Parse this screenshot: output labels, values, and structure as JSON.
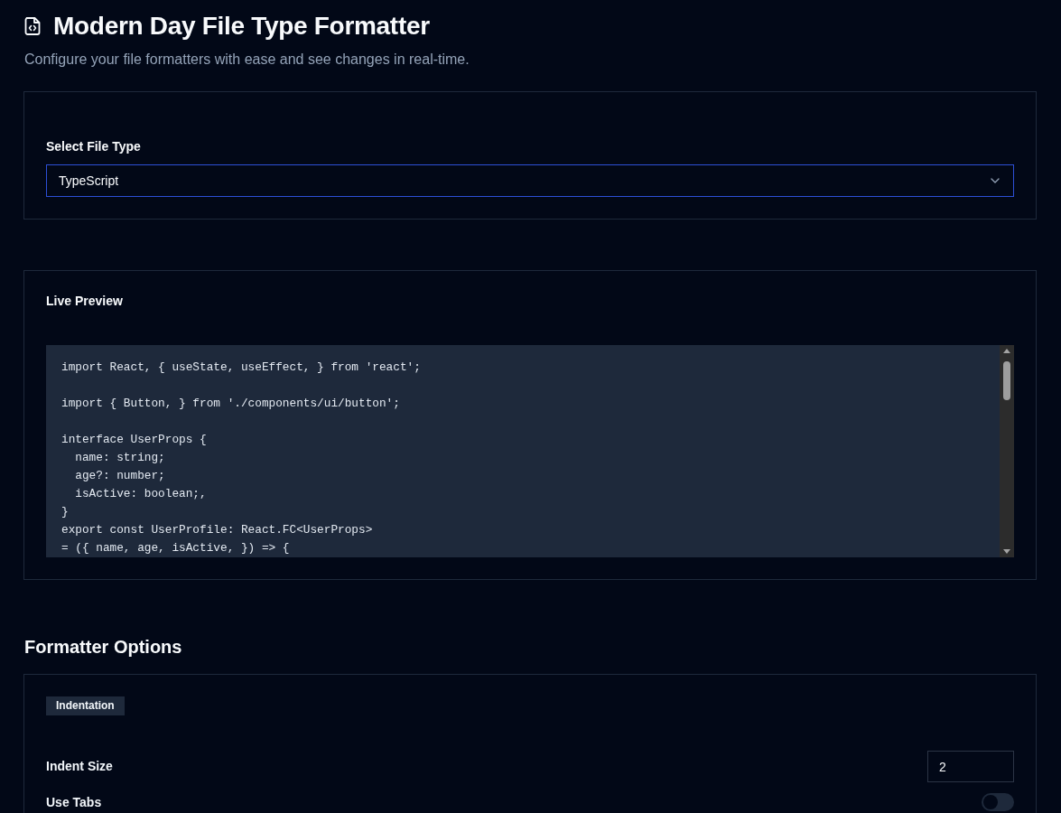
{
  "header": {
    "title": "Modern Day File Type Formatter",
    "subtitle": "Configure your file formatters with ease and see changes in real-time."
  },
  "file_type": {
    "label": "Select File Type",
    "value": "TypeScript",
    "focused": true
  },
  "preview": {
    "label": "Live Preview",
    "code": "import React, { useState, useEffect, } from 'react';\n\nimport { Button, } from './components/ui/button';\n\ninterface UserProps {\n  name: string;\n  age?: number;\n  isActive: boolean;,\n}\nexport const UserProfile: React.FC<UserProps>\n= ({ name, age, isActive, }) => {"
  },
  "options": {
    "heading": "Formatter Options",
    "groups": [
      {
        "title": "Indentation",
        "rows": [
          {
            "kind": "number",
            "label": "Indent Size",
            "value": "2"
          },
          {
            "kind": "toggle",
            "label": "Use Tabs",
            "on": false
          }
        ]
      }
    ]
  }
}
